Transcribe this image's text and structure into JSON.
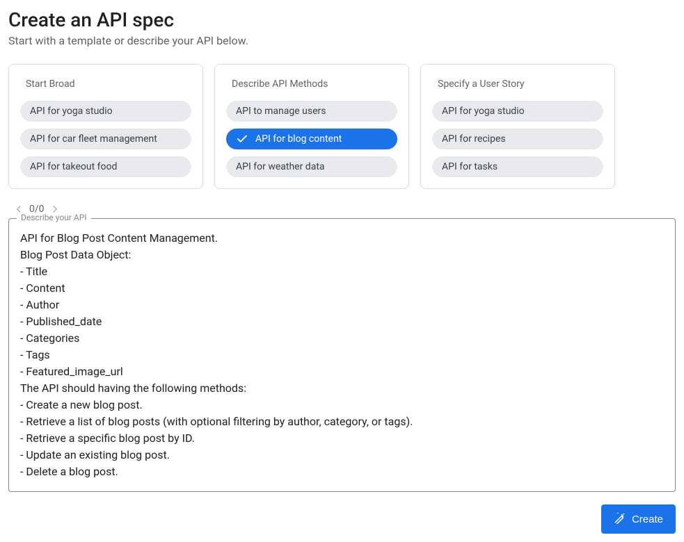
{
  "header": {
    "title": "Create an API spec",
    "subtitle": "Start with a template or describe your API below."
  },
  "cards": [
    {
      "title": "Start Broad",
      "chips": [
        {
          "label": "API for yoga studio",
          "selected": false
        },
        {
          "label": "API for car fleet management",
          "selected": false
        },
        {
          "label": "API for takeout food",
          "selected": false
        }
      ]
    },
    {
      "title": "Describe API Methods",
      "chips": [
        {
          "label": "API to manage users",
          "selected": false
        },
        {
          "label": "API for blog content",
          "selected": true
        },
        {
          "label": "API for weather data",
          "selected": false
        }
      ]
    },
    {
      "title": "Specify a User Story",
      "chips": [
        {
          "label": "API for yoga studio",
          "selected": false
        },
        {
          "label": "API for recipes",
          "selected": false
        },
        {
          "label": "API for tasks",
          "selected": false
        }
      ]
    }
  ],
  "pager": {
    "text": "0/0"
  },
  "describe": {
    "label": "Describe your API",
    "value": "API for Blog Post Content Management.\nBlog Post Data Object:\n- Title\n- Content\n- Author\n- Published_date\n- Categories\n- Tags\n- Featured_image_url\nThe API should having the following methods:\n- Create a new blog post.\n- Retrieve a list of blog posts (with optional filtering by author, category, or tags).\n- Retrieve a specific blog post by ID.\n- Update an existing blog post.\n- Delete a blog post."
  },
  "footer": {
    "create_label": "Create"
  },
  "colors": {
    "accent": "#1a73e8",
    "chip_bg": "#e8eaed",
    "border": "#dadce0",
    "text_secondary": "#5f6368"
  }
}
